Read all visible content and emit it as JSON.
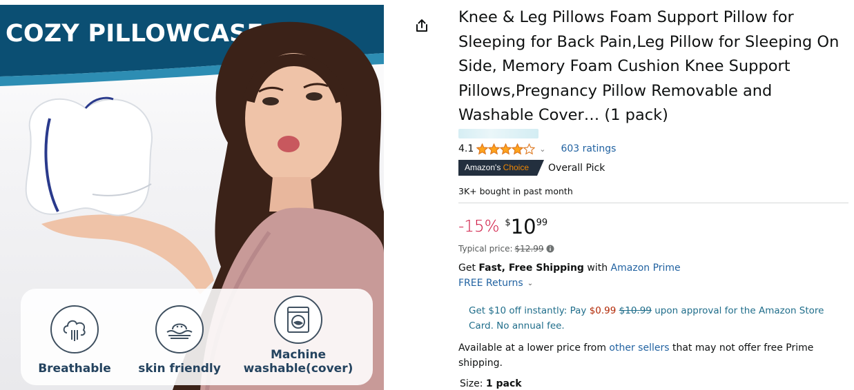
{
  "image": {
    "banner_title": "COZY PILLOWCASE",
    "features": [
      {
        "icon": "breathable-icon",
        "label": "Breathable"
      },
      {
        "icon": "skin-friendly-icon",
        "label": "skin friendly"
      },
      {
        "icon": "washing-machine-icon",
        "label": "Machine washable(cover)"
      }
    ],
    "colors": {
      "banner": "#0b4f73",
      "banner_accent": "#2d8db3"
    }
  },
  "product": {
    "title": "Knee & Leg Pillows Foam Support Pillow for Sleeping for Back Pain,Leg Pillow for Sleeping On Side, Memory Foam Cushion Knee Support Pillows,Pregnancy Pillow Removable and Washable Cover… (1 pack)",
    "rating": "4.1",
    "rating_stars": 4.1,
    "ratings_count": "603 ratings",
    "badge_prefix": "Amazon's",
    "badge_choice": "Choice",
    "badge_caption": "Overall Pick",
    "bought": "3K+ bought in past month"
  },
  "price": {
    "discount": "-15%",
    "currency": "$",
    "whole": "10",
    "fraction": "99",
    "typical_label": "Typical price:",
    "typical_value": "$12.99"
  },
  "shipping": {
    "prefix": "Get ",
    "bold": "Fast, Free Shipping",
    "middle": " with ",
    "link": "Amazon Prime",
    "returns": "FREE Returns"
  },
  "offer": {
    "part1": "Get $10 off instantly: Pay ",
    "pay": "$0.99",
    "old": "$10.99",
    "part2": " upon approval for the Amazon Store Card. No annual fee."
  },
  "lower_price": {
    "part1": "Available at a lower price from ",
    "link": "other sellers",
    "part2": " that may not offer free Prime shipping."
  },
  "size": {
    "label": "Size: ",
    "value": "1 pack"
  },
  "colors": {
    "link": "#2162a1",
    "star": "#ffa41c",
    "discount": "#cc0c39",
    "badge_bg": "#232f3e",
    "badge_choice": "#f08804"
  }
}
